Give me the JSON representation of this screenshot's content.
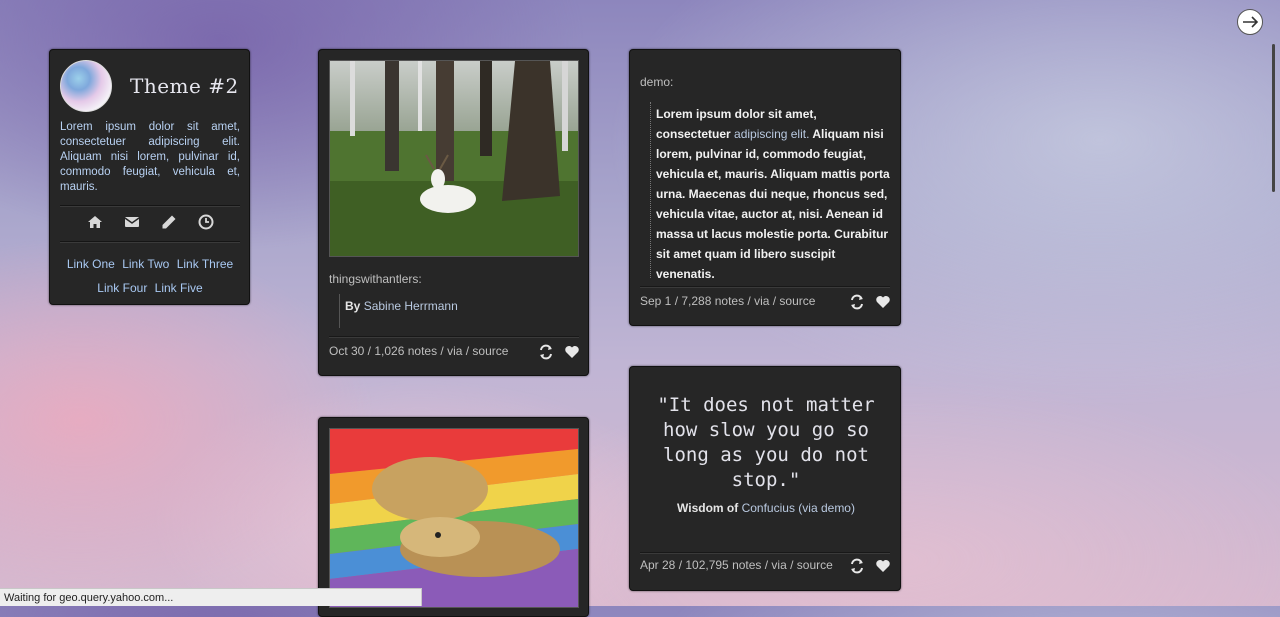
{
  "sidebar": {
    "title": "Theme #2",
    "description": "Lorem ipsum dolor sit amet, consectetuer adipiscing elit. Aliquam nisi lorem, pulvinar id, commodo feugiat, vehicula et, mauris.",
    "icons": [
      "home-icon",
      "mail-icon",
      "pencil-icon",
      "clock-icon"
    ],
    "links": [
      "Link One",
      "Link Two",
      "Link Three",
      "Link Four",
      "Link Five"
    ]
  },
  "post1": {
    "source_user": "thingswithantlers:",
    "by_label": "By",
    "by_name": "Sabine Herrmann",
    "meta": "Oct 30 / 1,026 notes / via / source"
  },
  "post2": {
    "source_user": "demo:",
    "quote_part1": "Lorem ipsum dolor sit amet, consectetuer",
    "quote_link": "adipiscing elit.",
    "quote_part2": "Aliquam nisi lorem, pulvinar id, commodo feugiat, vehicula et, mauris. Aliquam mattis porta urna. Maecenas dui neque, rhoncus sed, vehicula vitae, auctor at, nisi. Aenean id massa ut lacus molestie porta. Curabitur sit amet quam id libero suscipit venenatis.",
    "meta": "Sep 1 / 7,288 notes / via / source"
  },
  "post4": {
    "quote": "\"It does not matter how slow you go so long as you do not stop.\"",
    "attr_prefix": "Wisdom of",
    "attr_name": "Confucius",
    "attr_via": "(via demo)",
    "meta": "Apr 28 / 102,795 notes / via / source"
  },
  "status_bar": "Waiting for geo.query.yahoo.com...",
  "colors": {
    "panel": "#262626",
    "link": "#a9c9f3",
    "text": "#d0d0d0"
  }
}
